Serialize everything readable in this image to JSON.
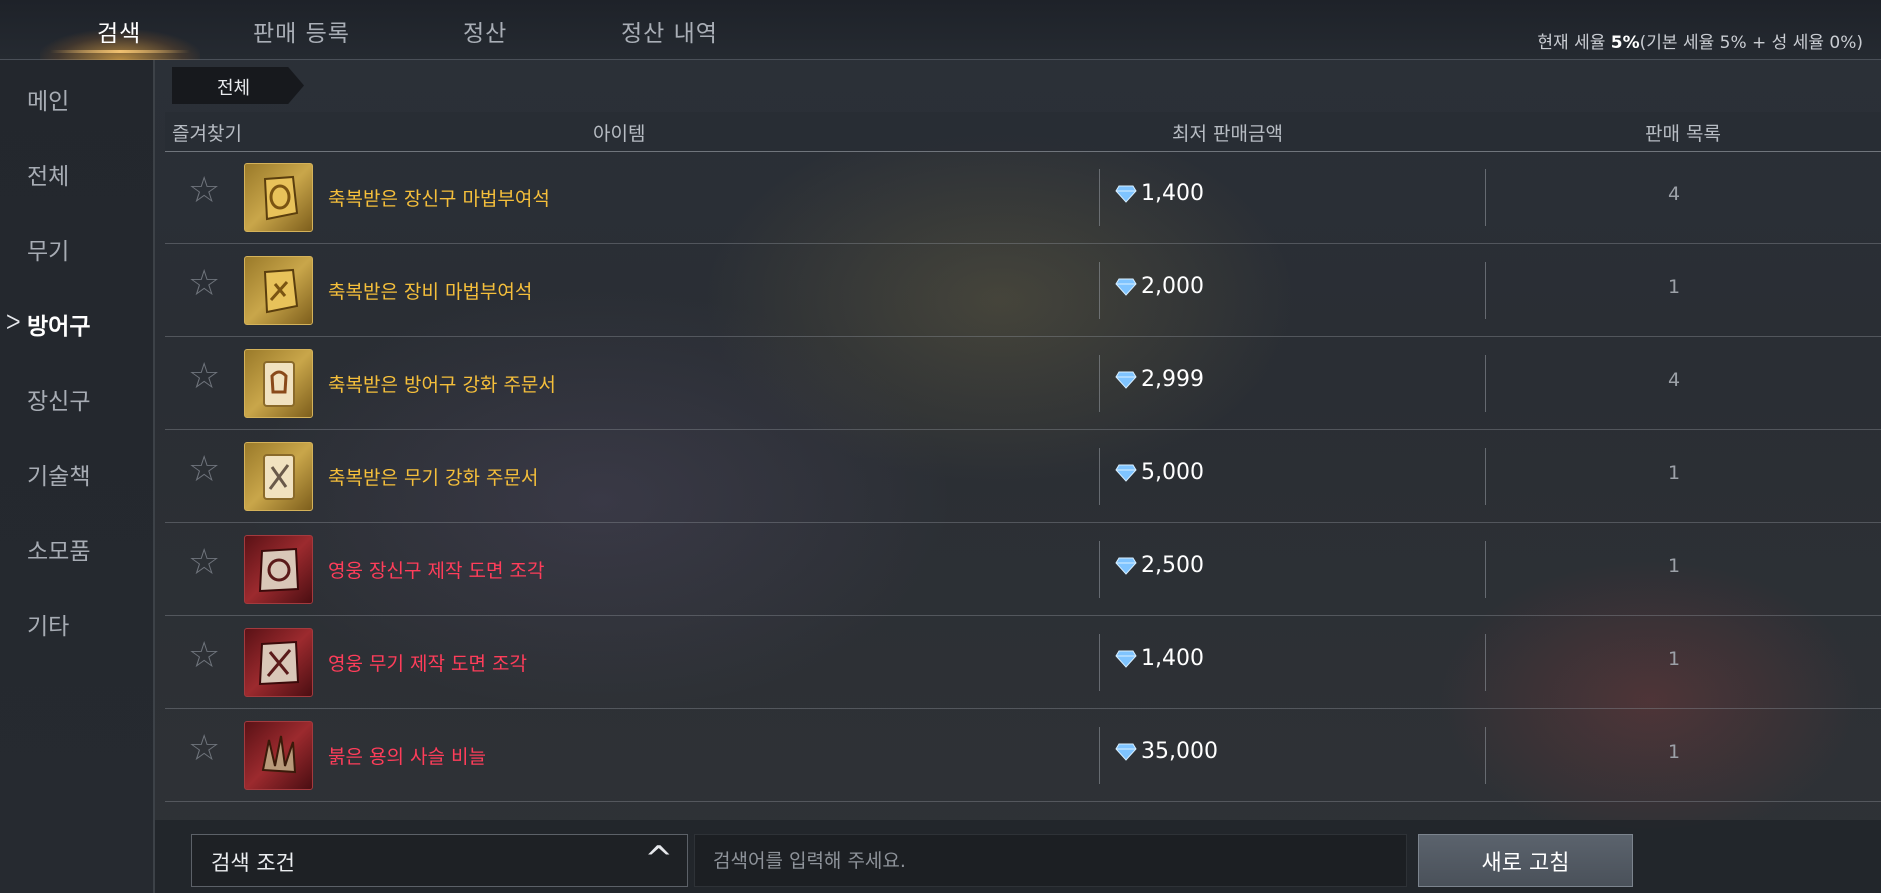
{
  "tabs": [
    {
      "label": "검색",
      "active": true
    },
    {
      "label": "판매 등록",
      "active": false
    },
    {
      "label": "정산",
      "active": false
    },
    {
      "label": "정산 내역",
      "active": false
    }
  ],
  "tax": {
    "prefix": "현재 세율 ",
    "rate": "5%",
    "detail": "(기본 세율 5% + 성 세율 0%)"
  },
  "sidebar": {
    "items": [
      {
        "label": "메인"
      },
      {
        "label": "전체"
      },
      {
        "label": "무기"
      },
      {
        "label": "방어구",
        "active": true
      },
      {
        "label": "장신구"
      },
      {
        "label": "기술책"
      },
      {
        "label": "소모품"
      },
      {
        "label": "기타"
      }
    ],
    "active_marker": "ᐳ"
  },
  "breadcrumb": "전체",
  "table": {
    "headers": {
      "favorite": "즐겨찾기",
      "item": "아이템",
      "lowest_price": "최저 판매금액",
      "listings": "판매 목록"
    },
    "rows": [
      {
        "name": "축복받은 장신구 마법부여석",
        "grade": "gold",
        "icon": "ring-enchant-stone-icon",
        "price": "1,400",
        "count": "4"
      },
      {
        "name": "축복받은 장비 마법부여석",
        "grade": "gold",
        "icon": "equipment-enchant-stone-icon",
        "price": "2,000",
        "count": "1"
      },
      {
        "name": "축복받은 방어구 강화 주문서",
        "grade": "gold",
        "icon": "armor-scroll-icon",
        "price": "2,999",
        "count": "4"
      },
      {
        "name": "축복받은 무기 강화 주문서",
        "grade": "gold",
        "icon": "weapon-scroll-icon",
        "price": "5,000",
        "count": "1"
      },
      {
        "name": "영웅 장신구 제작 도면 조각",
        "grade": "red",
        "icon": "accessory-blueprint-icon",
        "price": "2,500",
        "count": "1"
      },
      {
        "name": "영웅 무기 제작 도면 조각",
        "grade": "red",
        "icon": "weapon-blueprint-icon",
        "price": "1,400",
        "count": "1"
      },
      {
        "name": "붉은 용의 사슬 비늘",
        "grade": "red",
        "icon": "dragon-scale-icon",
        "price": "35,000",
        "count": "1"
      }
    ]
  },
  "bottom": {
    "search_condition": "검색 조건",
    "search_placeholder": "검색어를 입력해 주세요.",
    "refresh_label": "새로 고침"
  },
  "colors": {
    "gold_name": "#f5bf3b",
    "red_name": "#ff3d5a",
    "accent": "#f0c070"
  }
}
